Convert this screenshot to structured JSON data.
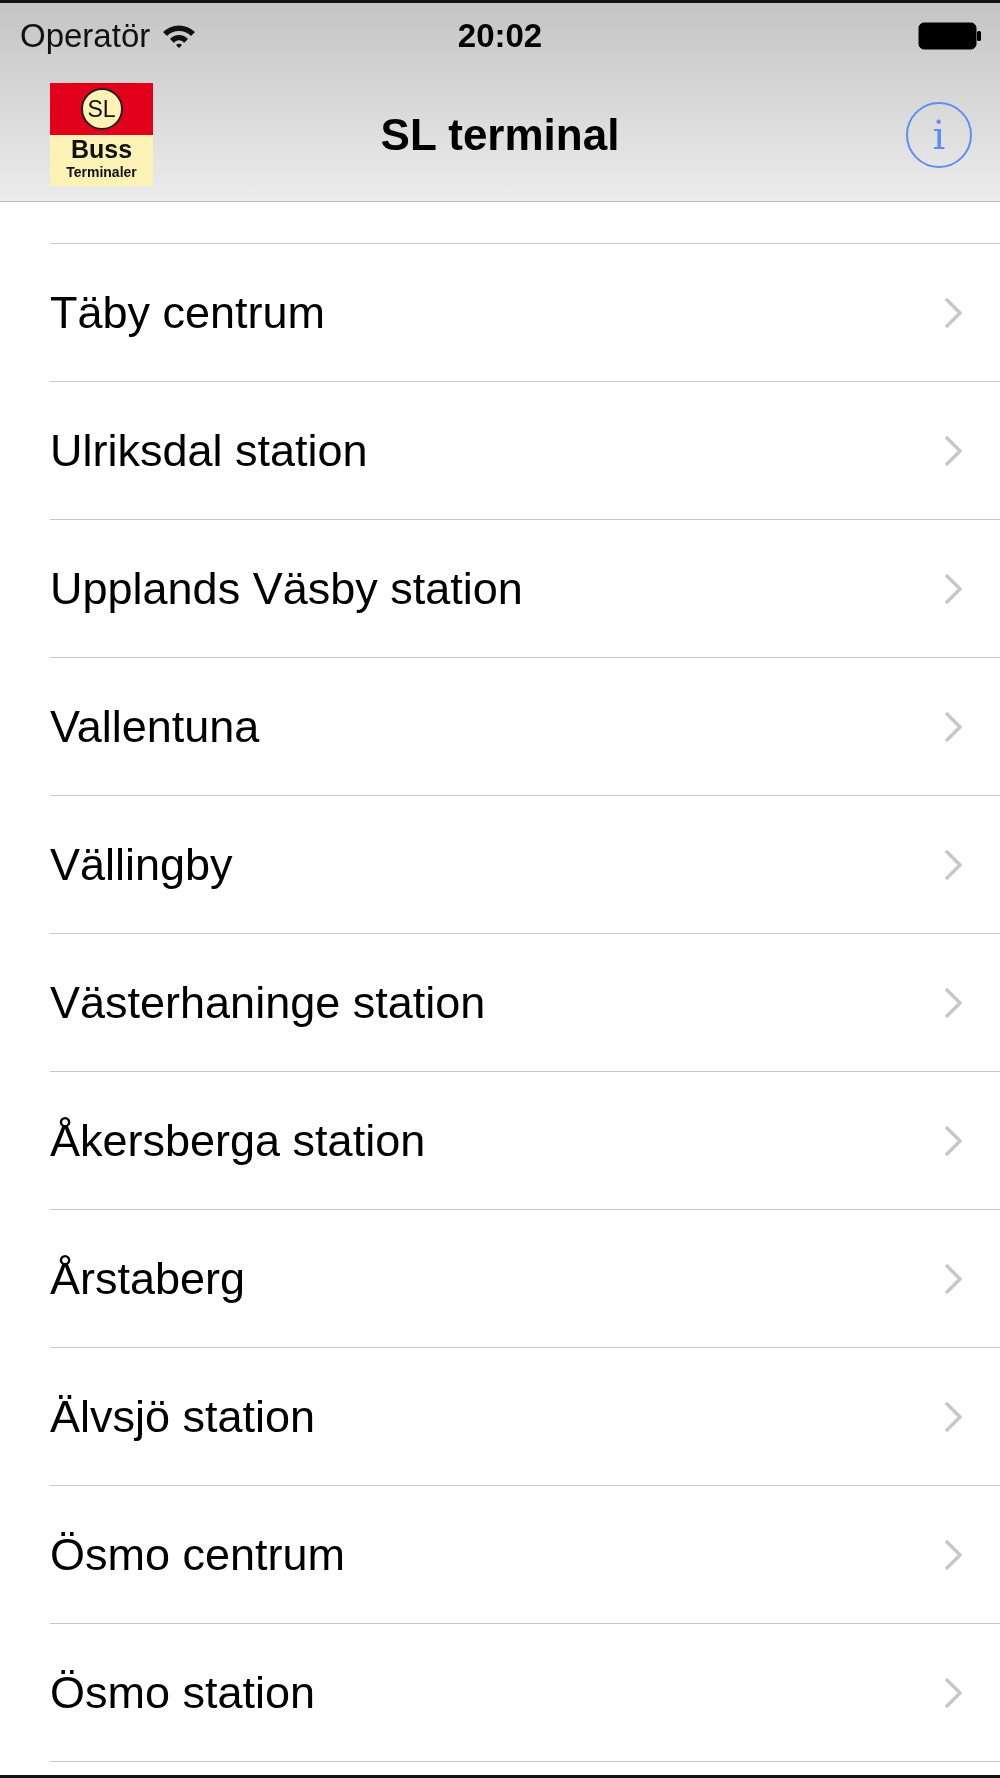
{
  "status_bar": {
    "carrier": "Operatör",
    "time": "20:02"
  },
  "nav_bar": {
    "logo": {
      "top": "SL",
      "middle": "Buss",
      "bottom": "Terminaler"
    },
    "title": "SL terminal",
    "info_button": "i"
  },
  "list": [
    {
      "label": "Täby centrum"
    },
    {
      "label": "Ulriksdal station"
    },
    {
      "label": "Upplands Väsby station"
    },
    {
      "label": "Vallentuna"
    },
    {
      "label": "Vällingby"
    },
    {
      "label": "Västerhaninge station"
    },
    {
      "label": "Åkersberga station"
    },
    {
      "label": "Årstaberg"
    },
    {
      "label": "Älvsjö station"
    },
    {
      "label": "Ösmo centrum"
    },
    {
      "label": "Ösmo station"
    }
  ]
}
